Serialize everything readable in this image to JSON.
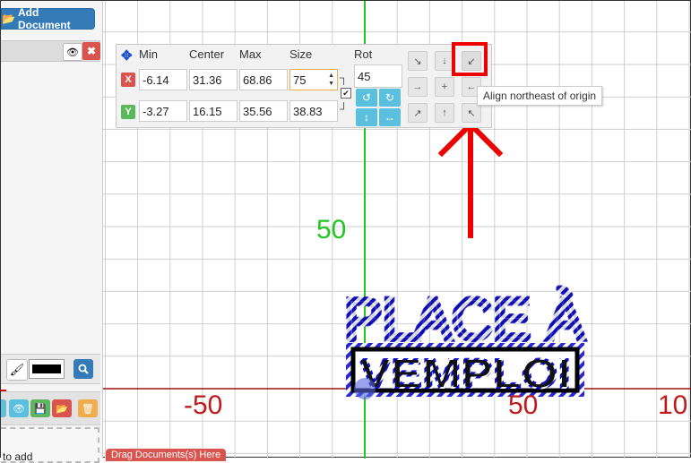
{
  "sidebar": {
    "add_document_label": "Add Document",
    "drop_text": "to add",
    "drag_banner": "Drag Documents(s) Here"
  },
  "transform_panel": {
    "headers": {
      "min": "Min",
      "center": "Center",
      "max": "Max",
      "size": "Size",
      "rot": "Rot"
    },
    "x": {
      "label": "X",
      "min": "-6.14",
      "center": "31.36",
      "max": "68.86",
      "size": "75"
    },
    "y": {
      "label": "Y",
      "min": "-3.27",
      "center": "16.15",
      "max": "35.56",
      "size": "38.83"
    },
    "rot": "45",
    "colors": {
      "x_badge": "#d9534f",
      "y_badge": "#5cb85c",
      "rotate_buttons": "#5bc0de"
    }
  },
  "align_grid": {
    "buttons": [
      "↘",
      "↓",
      "↙",
      "→",
      "+",
      "←",
      "↗",
      "↑",
      "↖"
    ],
    "highlighted_index": 2
  },
  "tooltip": "Align northeast of origin",
  "canvas": {
    "axis_labels": {
      "y_50": "50",
      "x_neg50": "-50",
      "x_50": "50",
      "x_100": "10"
    },
    "artwork_text": {
      "line1": "PLACE À",
      "line2": "VEMPLOI"
    },
    "colors": {
      "grid": "#cfcfcf",
      "y_axis": "#22c522",
      "x_axis": "#a01010",
      "selection": "#1010d0",
      "annotation": "#ee0000"
    }
  }
}
